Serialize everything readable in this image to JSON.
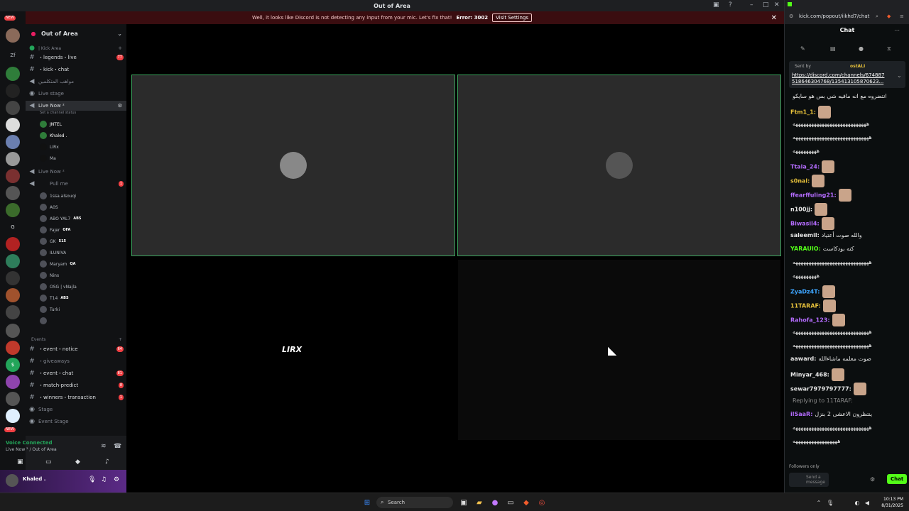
{
  "window": {
    "title": "Out of Area"
  },
  "banner": {
    "message": "Well, it looks like Discord is not detecting any input from your mic. Let's fix that!",
    "error": "Error: 3002",
    "button": "Visit Settings"
  },
  "rail": {
    "new_label": "NEW",
    "zf_label": "Zf",
    "g_label": "G",
    "new_bottom_label": "NEW"
  },
  "sidebar": {
    "server_name": "Out of Area",
    "category": "| Kick Area",
    "channels": {
      "legends": "・legends・live",
      "legends_count": "77",
      "kick_chat": "・kick・chat",
      "mawaheb": "مواهب المتكلمين",
      "live_stage": "Live stage",
      "live_now": "Live Now ²",
      "set_status": "Set a channel status",
      "live_now_2": "Live Now ²",
      "pull_me": "Pull me",
      "events": "Events",
      "event_notice": "・event・notice",
      "event_notice_count": "64",
      "giveaways": "・giveaways",
      "event_chat": "・event・chat",
      "event_chat_count": "81",
      "match_predict": "・match-predict",
      "match_predict_count": "8",
      "winners": "・winners・transaction",
      "winners_count": "1",
      "stage": "Stage",
      "event_stage": "Event Stage"
    },
    "live_members": [
      {
        "name": "JNTEL",
        "tag": ""
      },
      {
        "name": "Khaled .",
        "tag": ""
      },
      {
        "name": "LIRx",
        "tag": ""
      },
      {
        "name": "Ma",
        "tag": ""
      }
    ],
    "pull_members": [
      {
        "name": "1ssa.alsouqi",
        "tag": ""
      },
      {
        "name": "A0S",
        "tag": ""
      },
      {
        "name": "ABO YAL7",
        "tag": "ABS"
      },
      {
        "name": "Fajer",
        "tag": "OFA"
      },
      {
        "name": "GK",
        "tag": "515"
      },
      {
        "name": "ILUNIVA",
        "tag": ""
      },
      {
        "name": "Maryam",
        "tag": "QA"
      },
      {
        "name": "Nins",
        "tag": ""
      },
      {
        "name": "OSG | vNajla",
        "tag": ""
      },
      {
        "name": "T14",
        "tag": "ABS"
      },
      {
        "name": "Turki",
        "tag": ""
      },
      {
        "name": "",
        "tag": ""
      }
    ]
  },
  "voice": {
    "status": "Voice Connected",
    "location": "Live Now ² / Out of Area",
    "user": "Khaled ."
  },
  "stage": {
    "tiles": [
      {
        "logo": ""
      },
      {
        "logo": ""
      },
      {
        "logo": "LIRX"
      },
      {
        "logo": ""
      }
    ]
  },
  "browser": {
    "url": "kick.com/popout/iikhd7/chat",
    "chat_title": "Chat",
    "pinned": {
      "sent_by": "Sent by",
      "sender": "ostALI",
      "link": "https://discord.com/channels/674887518646304768/135413105870623..."
    },
    "messages": [
      {
        "user": "",
        "text": "انتضروه مع انه مافيه شي بس هو سايكو",
        "color": "#e6e6e6"
      },
      {
        "user": "Ftm1_1:",
        "text": "",
        "color": "#e8c23b"
      },
      {
        "user": "",
        "text": "ههههههههههههههههههههههههههههه",
        "color": "#e6e6e6"
      },
      {
        "user": "",
        "text": "هههههههههههههههههههههههههههههه",
        "color": "#e6e6e6"
      },
      {
        "user": "",
        "text": "هههههههههه",
        "color": "#e6e6e6"
      },
      {
        "user": "Ttala_24:",
        "text": "",
        "color": "#b46cff"
      },
      {
        "user": "s0nal:",
        "text": "",
        "color": "#e8c23b"
      },
      {
        "user": "ffearffuling21:",
        "text": "",
        "color": "#b46cff"
      },
      {
        "user": "n100jj:",
        "text": "",
        "color": "#e6e6e6"
      },
      {
        "user": "Biwasil4:",
        "text": "",
        "color": "#b46cff"
      },
      {
        "user": "saleemil:",
        "text": "والله صوت أعتياد",
        "color": "#e6e6e6"
      },
      {
        "user": "YARAUIO:",
        "text": "كنه بودكاست",
        "color": "#53fc18"
      },
      {
        "user": "",
        "text": "هههههههههههههههههههههههههههههه",
        "color": "#e6e6e6"
      },
      {
        "user": "",
        "text": "هههههههههه",
        "color": "#e6e6e6"
      },
      {
        "user": "ZyaDz4T:",
        "text": "",
        "color": "#3ea6ff"
      },
      {
        "user": "11TARAF:",
        "text": "",
        "color": "#e8c23b"
      },
      {
        "user": "Rahofa_123:",
        "text": "",
        "color": "#b46cff"
      },
      {
        "user": "",
        "text": "هههههههههههههههههههههههههههههه",
        "color": "#e6e6e6"
      },
      {
        "user": "",
        "text": "هههههههههههههههههههههههههههههه",
        "color": "#e6e6e6"
      },
      {
        "user": "aaward:",
        "text": "صوت معلمه ماشاءالله",
        "color": "#e6e6e6"
      },
      {
        "user": "Minyar_468:",
        "text": "",
        "color": "#e6e6e6"
      },
      {
        "user": "sewar7979797777:",
        "text": "",
        "color": "#e6e6e6"
      },
      {
        "user": "",
        "text": "Replying to 11TARAF:",
        "color": "#8a8a8a"
      },
      {
        "user": "ilSaaR:",
        "text": "ينتظرون الاعشى 2 بنزل",
        "color": "#b46cff"
      },
      {
        "user": "",
        "text": "هههههههههههههههههههههههههههههه",
        "color": "#e6e6e6"
      },
      {
        "user": "",
        "text": "هههههههههههههههههه",
        "color": "#e6e6e6"
      }
    ],
    "followers_only": "Followers only",
    "send_placeholder": "Send a message",
    "chat_button": "Chat"
  },
  "taskbar": {
    "search": "Search",
    "time": "10:13 PM",
    "date": "8/31/2025"
  }
}
